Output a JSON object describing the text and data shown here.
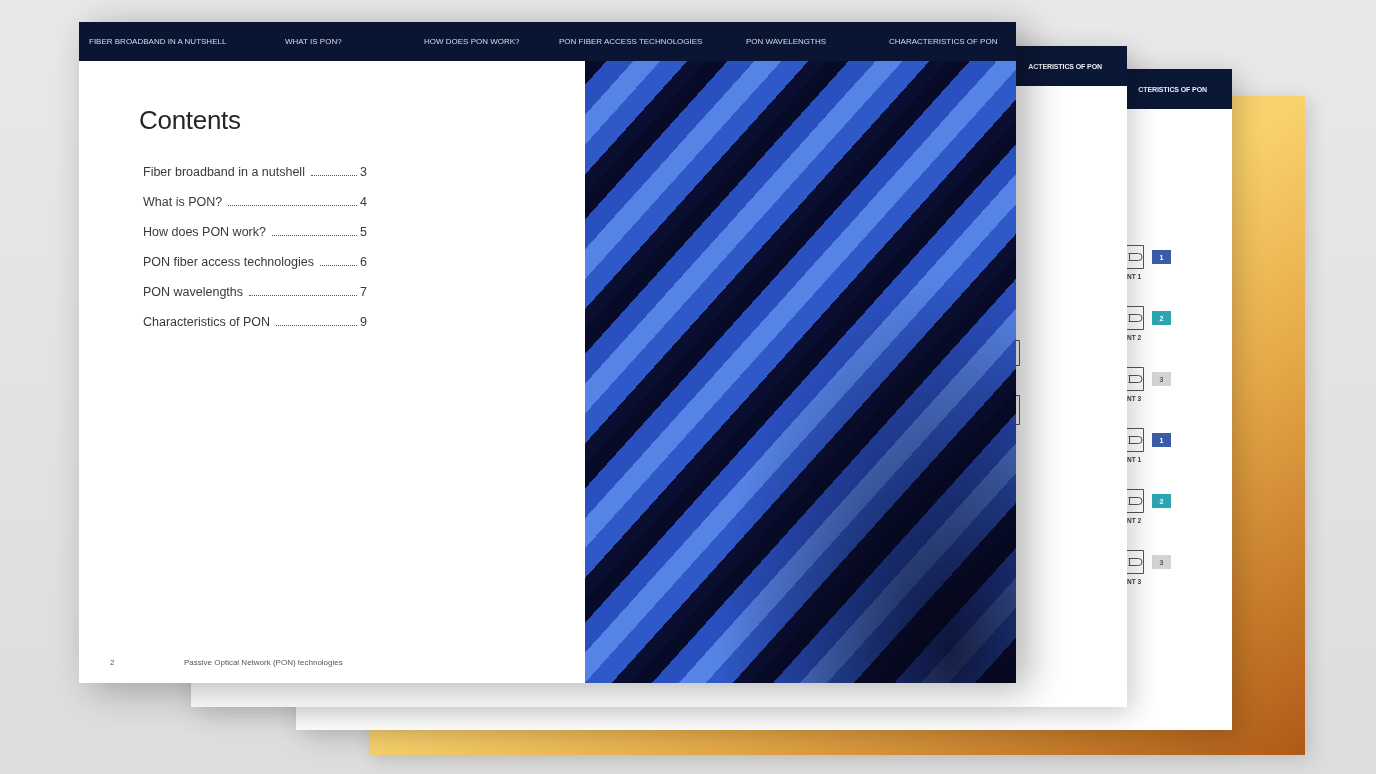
{
  "front_page": {
    "nav": [
      "FIBER BROADBAND IN A NUTSHELL",
      "WHAT IS PON?",
      "HOW DOES PON WORK?",
      "PON FIBER ACCESS TECHNOLOGIES",
      "PON WAVELENGTHS",
      "CHARACTERISTICS OF PON"
    ],
    "heading": "Contents",
    "toc": [
      {
        "title": "Fiber broadband in a nutshell",
        "page": "3"
      },
      {
        "title": "What is PON?",
        "page": "4"
      },
      {
        "title": "How does PON work?",
        "page": "5"
      },
      {
        "title": "PON fiber access technologies",
        "page": "6"
      },
      {
        "title": "PON wavelengths",
        "page": "7"
      },
      {
        "title": "Characteristics of PON",
        "page": "9"
      }
    ],
    "footer": {
      "page_number": "2",
      "title": "Passive Optical Network (PON) technologies"
    }
  },
  "back_pages": [
    {
      "header": "ACTERISTICS OF PON"
    },
    {
      "header": "CTERISTICS OF PON",
      "onts": [
        {
          "label": "NT 1",
          "number": "1",
          "color": "#3a5ca8"
        },
        {
          "label": "NT 2",
          "number": "2",
          "color": "#2aa5b1"
        },
        {
          "label": "NT 3",
          "number": "3",
          "color": "#d3d3d3"
        },
        {
          "label": "NT 1",
          "number": "1",
          "color": "#3a5ca8"
        },
        {
          "label": "NT 2",
          "number": "2",
          "color": "#2aa5b1"
        },
        {
          "label": "NT 3",
          "number": "3",
          "color": "#d3d3d3"
        }
      ]
    }
  ]
}
